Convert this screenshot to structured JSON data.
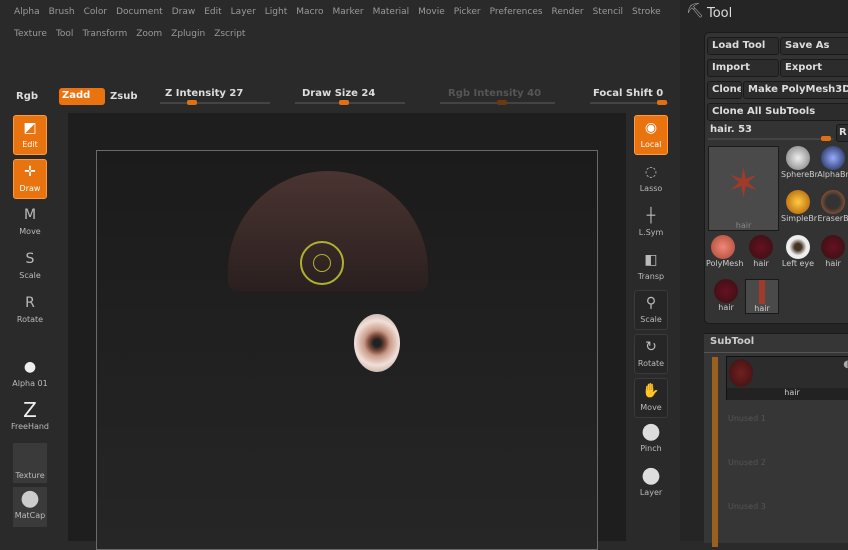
{
  "menu_row1": [
    "Alpha",
    "Brush",
    "Color",
    "Document",
    "Draw",
    "Edit",
    "Layer",
    "Light",
    "Macro",
    "Marker",
    "Material",
    "Movie",
    "Picker",
    "Preferences",
    "Render",
    "Stencil",
    "Stroke"
  ],
  "menu_row2": [
    "Texture",
    "Tool",
    "Transform",
    "Zoom",
    "Zplugin",
    "Zscript"
  ],
  "top": {
    "rgb": "Rgb",
    "zadd": "Zadd",
    "zsub": "Zsub",
    "z_intensity": "Z Intensity 27",
    "draw_size": "Draw Size 24",
    "rgb_intensity": "Rgb Intensity 40",
    "focal_shift": "Focal Shift 0"
  },
  "sliders": {
    "z_intensity": 27,
    "draw_size": 24,
    "rgb_intensity": 40,
    "focal_shift": 0
  },
  "left": [
    "Edit",
    "Draw",
    "Move",
    "Scale",
    "Rotate",
    "Alpha 01",
    "FreeHand",
    "Texture",
    "MatCap"
  ],
  "right": [
    "Local",
    "Lasso",
    "L.Sym",
    "Transp",
    "Scale",
    "Rotate",
    "Move",
    "Pinch",
    "Layer"
  ],
  "tool": {
    "title": "Tool",
    "load": "Load Tool",
    "save": "Save As",
    "import": "Import",
    "export": "Export",
    "clone": "Clone",
    "make": "Make PolyMesh3D",
    "clone_all": "Clone All SubTools",
    "current": "hair. 53",
    "r": "R",
    "main_thumb": "hair",
    "thumbs": [
      "SphereBr",
      "AlphaBr",
      "SimpleBr",
      "EraserB",
      "PolyMesh",
      "hair",
      "Left eye",
      "hair",
      "hair",
      "hair"
    ]
  },
  "subtool": {
    "title": "SubTool",
    "item": "hair",
    "unused": [
      "Unused 1",
      "Unused 2",
      "Unused 3"
    ]
  }
}
